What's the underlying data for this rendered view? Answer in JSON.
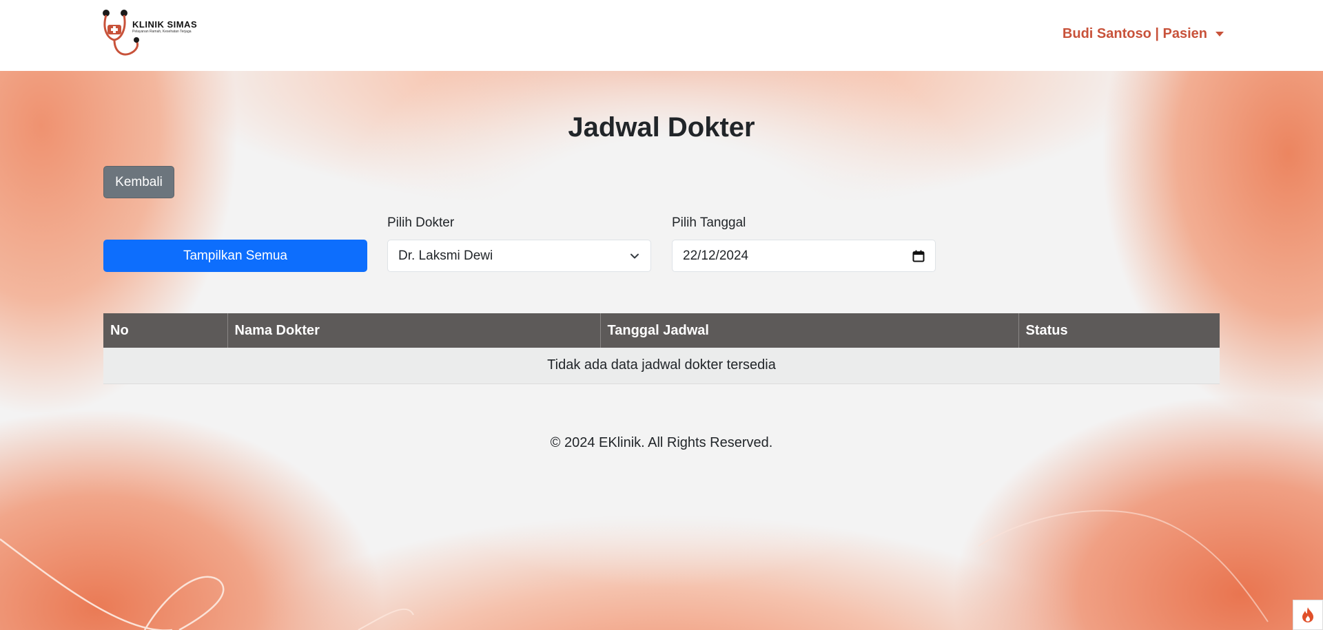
{
  "brand": {
    "name": "KLINIK SIMAS",
    "tagline": "Pelayanan Ramah, Kesehatan Terjaga"
  },
  "user_menu": {
    "label": "Budi Santoso | Pasien"
  },
  "page": {
    "title": "Jadwal Dokter",
    "back_button": "Kembali",
    "show_all_button": "Tampilkan Semua"
  },
  "filters": {
    "doctor_label": "Pilih Dokter",
    "doctor_selected": "Dr. Laksmi Dewi",
    "date_label": "Pilih Tanggal",
    "date_value": "22/12/2024"
  },
  "table": {
    "headers": [
      "No",
      "Nama Dokter",
      "Tanggal Jadwal",
      "Status"
    ],
    "empty_message": "Tidak ada data jadwal dokter tersedia"
  },
  "footer": {
    "text": "© 2024 EKlinik. All Rights Reserved."
  },
  "colors": {
    "brand_accent": "#c8523a",
    "primary_button": "#0d6efd",
    "secondary_button": "#6c757d",
    "table_header": "#5d5a59"
  }
}
